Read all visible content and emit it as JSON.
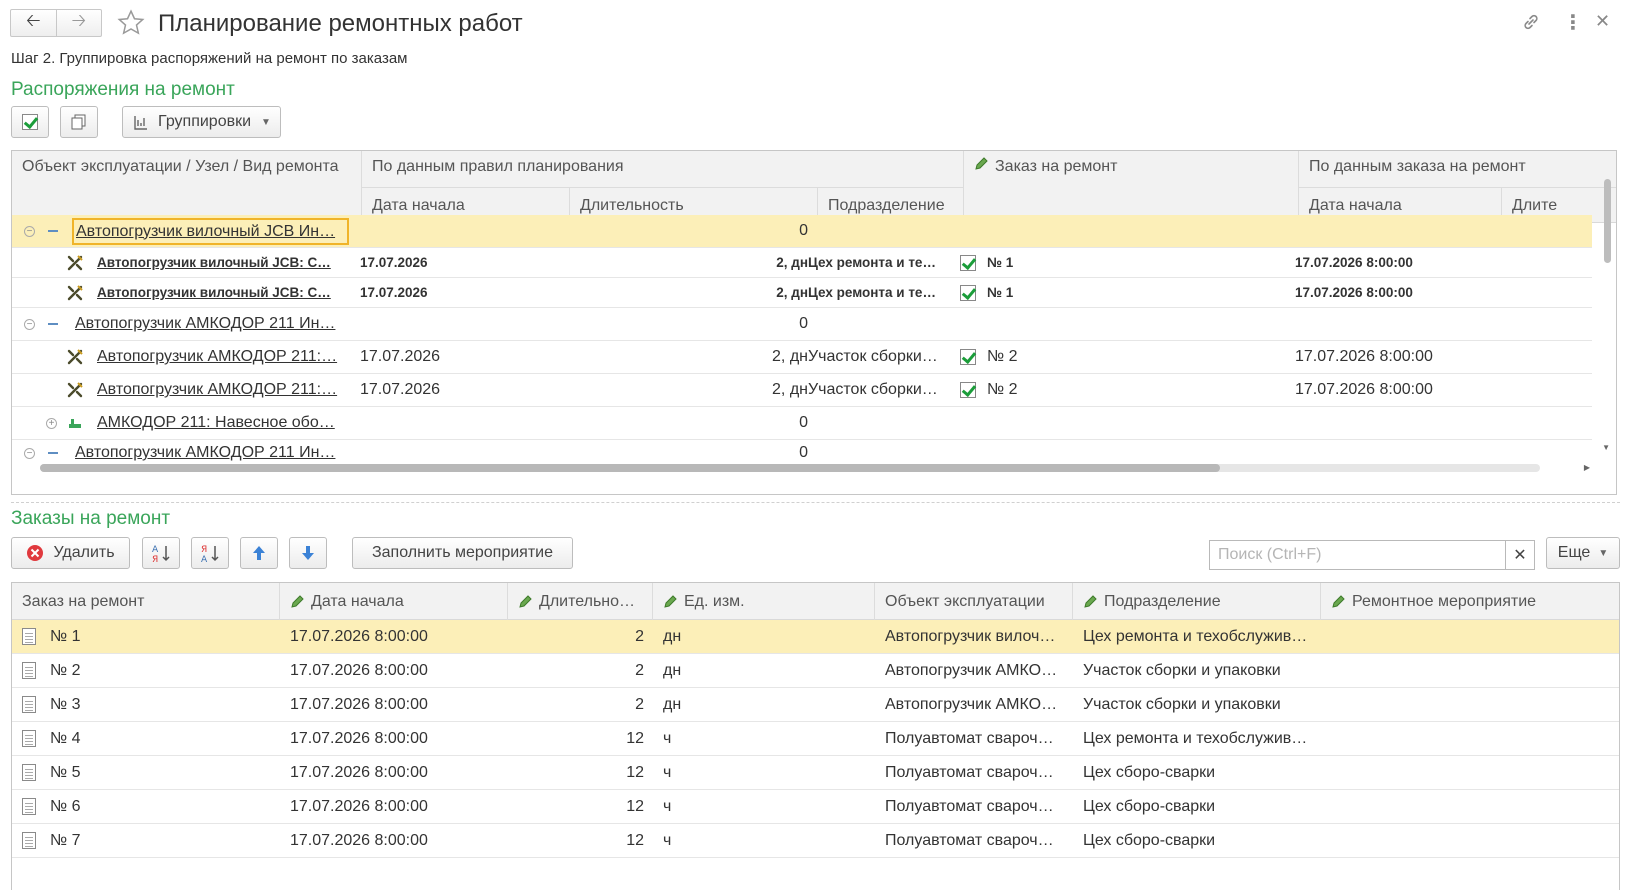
{
  "window": {
    "title": "Планирование ремонтных работ",
    "step": "Шаг 2. Группировка распоряжений на ремонт по заказам"
  },
  "section1": {
    "title": "Распоряжения на ремонт",
    "groupings_button": "Группировки"
  },
  "orders_table": {
    "col_object": "Объект эксплуатации / Узел / Вид ремонта",
    "group_planning": "По данным правил планирования",
    "col_start": "Дата начала",
    "col_duration": "Длительность",
    "col_division": "Подразделение",
    "col_order": "Заказ на ремонт",
    "group_order": "По данным заказа на ремонт",
    "col_order_start": "Дата начала",
    "col_order_dur": "Длите",
    "rows": [
      {
        "level": 0,
        "name": "Автопогрузчик вилочный JCB Ин…",
        "start": "",
        "duration": "0",
        "division": "",
        "order": "",
        "order_start": ""
      },
      {
        "level": 1,
        "name": "Автопогрузчик вилочный JCB: С…",
        "start": "17.07.2026",
        "duration": "2, дн",
        "division": "Цех ремонта и те…",
        "order": "№ 1",
        "order_start": "17.07.2026 8:00:00"
      },
      {
        "level": 1,
        "name": "Автопогрузчик вилочный JCB: С…",
        "start": "17.07.2026",
        "duration": "2, дн",
        "division": "Цех ремонта и те…",
        "order": "№ 1",
        "order_start": "17.07.2026 8:00:00"
      },
      {
        "level": 0,
        "name": "Автопогрузчик АМКОДОР 211 Ин…",
        "start": "",
        "duration": "0",
        "division": "",
        "order": "",
        "order_start": ""
      },
      {
        "level": 1,
        "name": "Автопогрузчик АМКОДОР 211:…",
        "start": "17.07.2026",
        "duration": "2, дн",
        "division": "Участок сборки…",
        "order": "№ 2",
        "order_start": "17.07.2026 8:00:00"
      },
      {
        "level": 1,
        "name": "Автопогрузчик АМКОДОР 211:…",
        "start": "17.07.2026",
        "duration": "2, дн",
        "division": "Участок сборки…",
        "order": "№ 2",
        "order_start": "17.07.2026 8:00:00"
      },
      {
        "level": 1,
        "name": "АМКОДОР 211: Навесное обо…",
        "start": "",
        "duration": "0",
        "division": "",
        "order": "",
        "order_start": ""
      },
      {
        "level": 0,
        "name": "Автопогрузчик АМКОДОР 211 Ин…",
        "start": "",
        "duration": "0",
        "division": "",
        "order": "",
        "order_start": ""
      }
    ]
  },
  "section2": {
    "title": "Заказы на ремонт",
    "delete_button": "Удалить",
    "fill_button": "Заполнить мероприятие",
    "search_placeholder": "Поиск (Ctrl+F)",
    "more_button": "Еще"
  },
  "repair_table": {
    "col_order": "Заказ на ремонт",
    "col_start": "Дата начала",
    "col_duration": "Длительно…",
    "col_unit": "Ед. изм.",
    "col_object": "Объект эксплуатации",
    "col_division": "Подразделение",
    "col_event": "Ремонтное мероприятие",
    "rows": [
      {
        "order": "№ 1",
        "start": "17.07.2026 8:00:00",
        "duration": "2",
        "unit": "дн",
        "object": "Автопогрузчик вилоч…",
        "division": "Цех ремонта и техобслужив…",
        "event": ""
      },
      {
        "order": "№ 2",
        "start": "17.07.2026 8:00:00",
        "duration": "2",
        "unit": "дн",
        "object": "Автопогрузчик АМКО…",
        "division": "Участок сборки и упаковки",
        "event": ""
      },
      {
        "order": "№ 3",
        "start": "17.07.2026 8:00:00",
        "duration": "2",
        "unit": "дн",
        "object": "Автопогрузчик АМКО…",
        "division": "Участок сборки и упаковки",
        "event": ""
      },
      {
        "order": "№ 4",
        "start": "17.07.2026 8:00:00",
        "duration": "12",
        "unit": "ч",
        "object": "Полуавтомат свароч…",
        "division": "Цех ремонта и техобслужив…",
        "event": ""
      },
      {
        "order": "№ 5",
        "start": "17.07.2026 8:00:00",
        "duration": "12",
        "unit": "ч",
        "object": "Полуавтомат свароч…",
        "division": "Цех сборо-сварки",
        "event": ""
      },
      {
        "order": "№ 6",
        "start": "17.07.2026 8:00:00",
        "duration": "12",
        "unit": "ч",
        "object": "Полуавтомат свароч…",
        "division": "Цех сборо-сварки",
        "event": ""
      },
      {
        "order": "№ 7",
        "start": "17.07.2026 8:00:00",
        "duration": "12",
        "unit": "ч",
        "object": "Полуавтомат свароч…",
        "division": "Цех сборо-сварки",
        "event": ""
      }
    ]
  }
}
